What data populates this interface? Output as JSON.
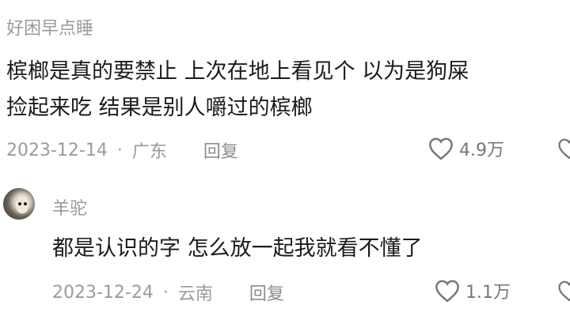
{
  "comments": [
    {
      "username": "好困早点睡",
      "text_lines": [
        "槟榔是真的要禁止 上次在地上看见个 以为是狗屎",
        "捡起来吃 结果是别人嚼过的槟榔"
      ],
      "date": "2023-12-14",
      "location": "广东",
      "reply_label": "回复",
      "likes": "4.9万"
    },
    {
      "username": "羊驼",
      "text_lines": [
        "都是认识的字 怎么放一起我就看不懂了"
      ],
      "date": "2023-12-24",
      "location": "云南",
      "reply_label": "回复",
      "likes": "1.1万"
    }
  ],
  "separator": "·",
  "icons": {
    "like": "heart-outline-icon",
    "avatar": "alpaca-avatar"
  },
  "colors": {
    "text": "#1b1b1b",
    "muted": "#9b9b9b",
    "icon": "#777777"
  }
}
